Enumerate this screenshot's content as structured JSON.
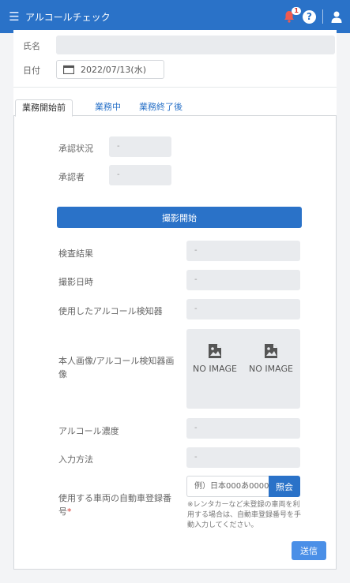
{
  "app": {
    "title": "アルコールチェック",
    "notification_badge": "1"
  },
  "form": {
    "name_label": "氏名",
    "date_label": "日付",
    "date_value": "2022/07/13(水)"
  },
  "tabs": [
    {
      "label": "業務開始前"
    },
    {
      "label": "業務中"
    },
    {
      "label": "業務終了後"
    }
  ],
  "approval": {
    "status_label": "承認状況",
    "status_value": "-",
    "approver_label": "承認者",
    "approver_value": "-"
  },
  "start_button": "撮影開始",
  "fields": {
    "result_label": "検査結果",
    "result_value": "-",
    "shot_datetime_label": "撮影日時",
    "shot_datetime_value": "-",
    "detector_label": "使用したアルコール検知器",
    "detector_value": "-",
    "images_label": "本人画像/アルコール検知器画像",
    "no_image_1": "NO IMAGE",
    "no_image_2": "NO IMAGE",
    "concentration_label": "アルコール濃度",
    "concentration_value": "-",
    "input_method_label": "入力方法",
    "input_method_value": "-",
    "plate_label": "使用する車両の自動車登録番号",
    "plate_required": "*",
    "plate_placeholder": "例）日本000あ0000",
    "lookup_button": "照会",
    "plate_note": "※レンタカーなど未登録の車両を利用する場合は、自動車登録番号を手動入力してください。"
  },
  "send_button": "送信",
  "colors": {
    "primary": "#2a72c8",
    "required": "#d9362e"
  },
  "icons": [
    "menu-icon",
    "bell-icon",
    "help-icon",
    "user-icon",
    "calendar-icon",
    "broken-image-icon"
  ]
}
